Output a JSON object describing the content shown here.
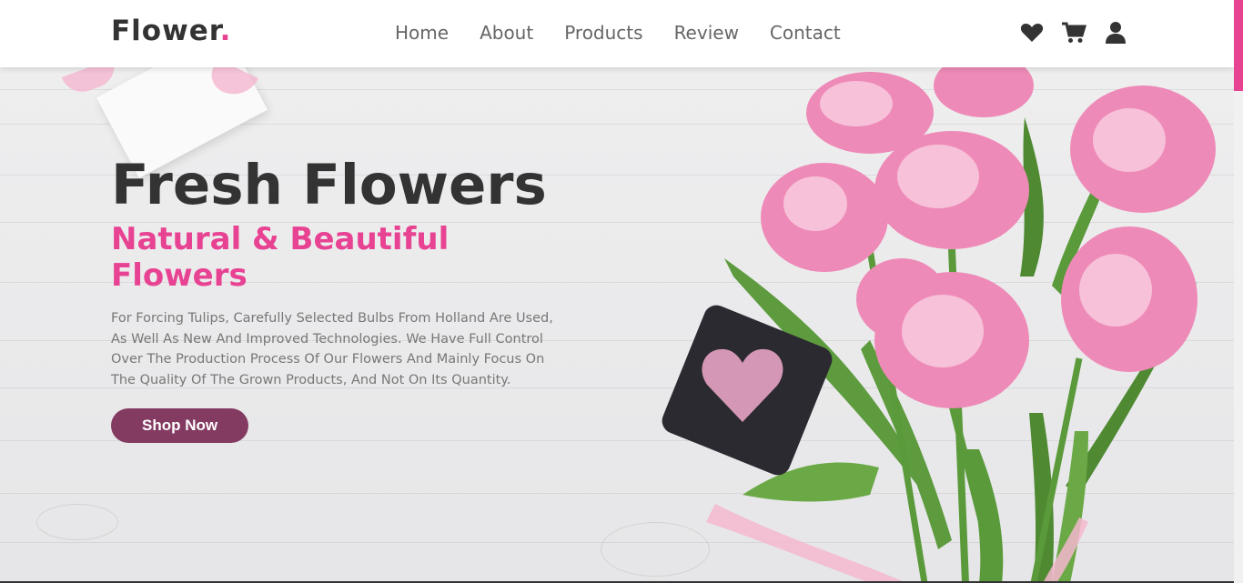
{
  "header": {
    "logo_text": "Flower",
    "logo_dot": ".",
    "nav": [
      {
        "label": "Home"
      },
      {
        "label": "About"
      },
      {
        "label": "Products"
      },
      {
        "label": "Review"
      },
      {
        "label": "Contact"
      }
    ],
    "icons": [
      "heart-icon",
      "cart-icon",
      "user-icon"
    ]
  },
  "hero": {
    "title": "Fresh Flowers",
    "subtitle": "Natural & Beautiful Flowers",
    "description": "For Forcing Tulips, Carefully Selected Bulbs From Holland Are Used, As Well As New And Improved Technologies. We Have Full Control Over The Production Process Of Our Flowers And Mainly Focus On The Quality Of The Grown Products, And Not On Its Quantity.",
    "button_label": "Shop Now"
  },
  "colors": {
    "accent": "#e84393",
    "button": "#843b62",
    "text_dark": "#333333",
    "text_muted": "#777777"
  }
}
